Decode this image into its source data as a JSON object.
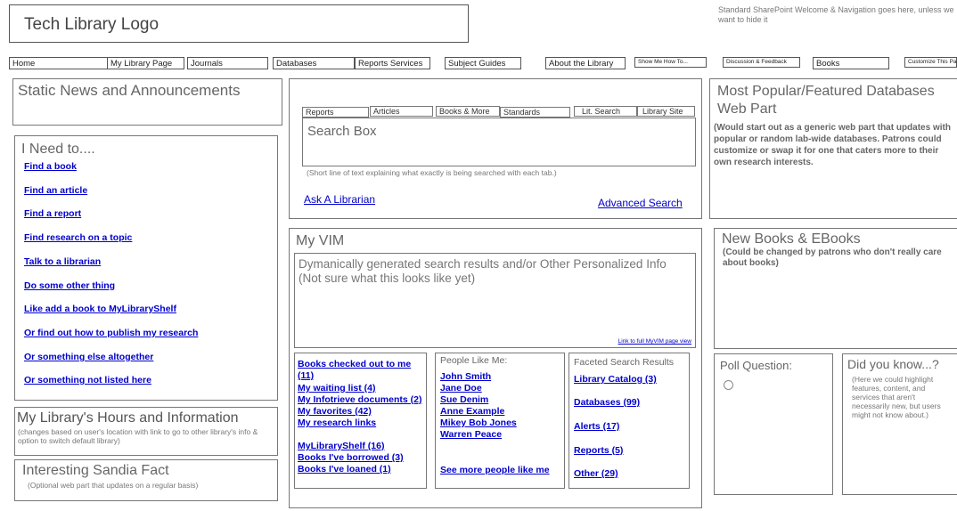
{
  "header": {
    "logo": "Tech Library Logo",
    "welcome": "Standard SharePoint Welcome & Navigation goes here, unless we want to hide it"
  },
  "nav": [
    {
      "label": "Home"
    },
    {
      "label": "My Library Page"
    },
    {
      "label": "Journals"
    },
    {
      "label": "Databases"
    },
    {
      "label": "Reports Services"
    },
    {
      "label": "Subject Guides"
    },
    {
      "label": "About the Library"
    },
    {
      "label": "Show Me How To..."
    },
    {
      "label": "Discussion & Feedback"
    },
    {
      "label": "Books"
    },
    {
      "label": "Customize This Page"
    }
  ],
  "news": {
    "title": "Static News and Announcements"
  },
  "ineed": {
    "title": "I Need to....",
    "links": [
      "Find a book",
      "Find an article",
      "Find a report",
      "Find research on a topic",
      "Talk to a librarian",
      "Do some other thing",
      "Like add a book to MyLibraryShelf",
      "Or find out how to publish my research",
      "Or something else altogether",
      "Or something not listed here"
    ]
  },
  "hours": {
    "title": "My Library's Hours and Information",
    "desc": "(changes based on user's location with link to go to other library's info & option to switch default library)"
  },
  "fact": {
    "title": "Interesting Sandia Fact",
    "desc": "(Optional web part that updates on a regular basis)"
  },
  "search": {
    "tabs": [
      "Reports",
      "Articles",
      "Books & More",
      "Standards",
      "Lit. Search",
      "Library Site"
    ],
    "box_label": "Search Box",
    "hint": "(Short line of text explaining what exactly is being searched with each tab.)",
    "ask": "Ask A Librarian",
    "advanced": "Advanced Search"
  },
  "myvim": {
    "title": "My VIM",
    "content_line1": "Dymanically generated search results and/or Other Personalized Info",
    "content_line2": "(Not sure what this looks like yet)",
    "full_link": "Link to full MyVIM page view",
    "my_links": [
      "Books checked out to me (11)",
      "My waiting list (4)",
      "My Infotrieve documents (2)",
      "My favorites (42)",
      "My research links"
    ],
    "shelf_links": [
      "MyLibraryShelf (16)",
      "Books I've borrowed (3)",
      "Books I've loaned (1)"
    ],
    "people": {
      "title": "People Like Me:",
      "names": [
        "John Smith",
        "Jane Doe",
        "Sue Denim",
        "Anne Example",
        "Mikey Bob Jones",
        "Warren Peace"
      ],
      "more": "See more people like me"
    },
    "faceted": {
      "title": "Faceted Search Results",
      "items": [
        "Library Catalog (3)",
        "Databases (99)",
        "Alerts (17)",
        "Reports (5)",
        "Other (29)"
      ]
    }
  },
  "popular": {
    "title": "Most Popular/Featured Databases Web Part",
    "desc": "(Would start out as a generic web part that updates with popular or random lab-wide databases. Patrons could customize or swap it for one that caters more to their own research interests."
  },
  "newbooks": {
    "title": "New Books & EBooks",
    "desc": "(Could be changed by patrons who don't really care about books)"
  },
  "poll": {
    "title": "Poll Question:"
  },
  "didyouknow": {
    "title": "Did you know...?",
    "desc": "(Here we could highlight features, content, and services that aren't necessarily new, but users might not know about.)"
  }
}
